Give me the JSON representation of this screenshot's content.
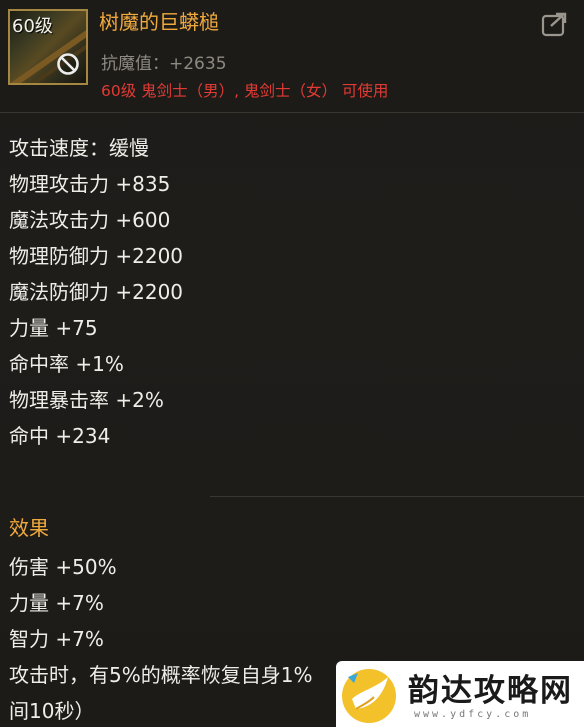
{
  "item": {
    "level_tag": "60级",
    "icon": "hammer-weapon-icon",
    "prohibit_icon": "prohibit-icon",
    "name": "树魔的巨蟒槌",
    "anti_magic": "抗魔值：+2635",
    "requirement": "60级 鬼剑士（男）, 鬼剑士（女） 可使用"
  },
  "header": {
    "share_icon": "share-icon"
  },
  "stats": [
    "攻击速度：缓慢",
    "物理攻击力 +835",
    "魔法攻击力 +600",
    "物理防御力 +2200",
    "魔法防御力 +2200",
    "力量 +75",
    "命中率 +1%",
    "物理暴击率 +2%",
    "命中 +234"
  ],
  "effects": {
    "title": "效果",
    "lines": [
      "伤害 +50%",
      "力量 +7%",
      "智力 +7%",
      "攻击时，有5%的概率恢复自身1%",
      "间10秒）"
    ]
  },
  "watermark": {
    "text": "韵达攻略网",
    "url": "www.ydfcy.com"
  },
  "colors": {
    "background": "#1e1c19",
    "title_gold": "#f0a93d",
    "requirement_red": "#e23a34",
    "stat_text": "#efede8",
    "muted_text": "#8e8a82",
    "icon_border": "#a58742"
  }
}
